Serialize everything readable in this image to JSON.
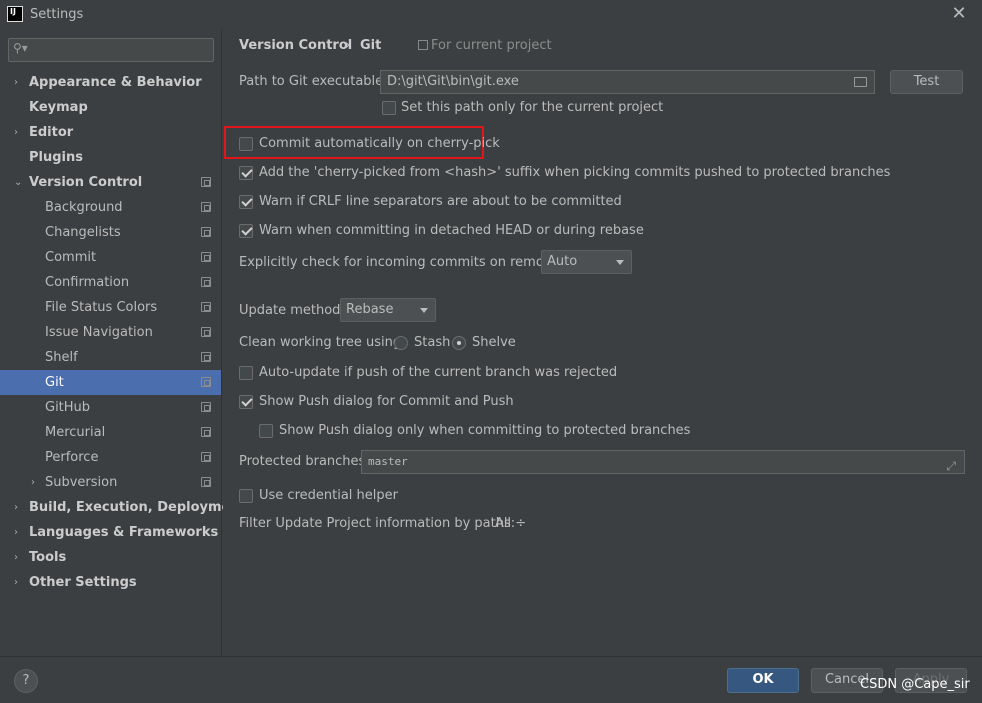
{
  "window": {
    "title": "Settings",
    "logo": "IJ",
    "close": "✕"
  },
  "search": {
    "placeholder": ""
  },
  "sidebar": {
    "items": [
      {
        "label": "Appearance & Behavior",
        "bold": true,
        "arrow": "›"
      },
      {
        "label": "Keymap",
        "bold": true
      },
      {
        "label": "Editor",
        "bold": true,
        "arrow": "›"
      },
      {
        "label": "Plugins",
        "bold": true
      },
      {
        "label": "Version Control",
        "bold": true,
        "arrow": "⌄"
      },
      {
        "label": "Background"
      },
      {
        "label": "Changelists"
      },
      {
        "label": "Commit"
      },
      {
        "label": "Confirmation"
      },
      {
        "label": "File Status Colors"
      },
      {
        "label": "Issue Navigation"
      },
      {
        "label": "Shelf"
      },
      {
        "label": "Git",
        "selected": true
      },
      {
        "label": "GitHub"
      },
      {
        "label": "Mercurial"
      },
      {
        "label": "Perforce"
      },
      {
        "label": "Subversion",
        "arrow": "›"
      },
      {
        "label": "Build, Execution, Deployment",
        "bold": true,
        "arrow": "›"
      },
      {
        "label": "Languages & Frameworks",
        "bold": true,
        "arrow": "›"
      },
      {
        "label": "Tools",
        "bold": true,
        "arrow": "›"
      },
      {
        "label": "Other Settings",
        "bold": true,
        "arrow": "›"
      }
    ]
  },
  "breadcrumb": {
    "parent": "Version Control",
    "sep": "›",
    "current": "Git",
    "scope": "For current project"
  },
  "git": {
    "path_label": "Path to Git executable:",
    "path_value": "D:\\git\\Git\\bin\\git.exe",
    "test_label": "Test",
    "set_path_only": "Set this path only for the current project",
    "commit_auto_cherry": "Commit automatically on cherry-pick",
    "add_suffix": "Add the 'cherry-picked from <hash>' suffix when picking commits pushed to protected branches",
    "warn_crlf": "Warn if CRLF line separators are about to be committed",
    "warn_detached": "Warn when committing in detached HEAD or during rebase",
    "check_incoming_label": "Explicitly check for incoming commits on remotes:",
    "check_incoming_value": "Auto",
    "update_method_label": "Update method:",
    "update_method_value": "Rebase",
    "clean_tree_label": "Clean working tree using:",
    "stash_label": "Stash",
    "shelve_label": "Shelve",
    "auto_update": "Auto-update if push of the current branch was rejected",
    "show_push_dialog": "Show Push dialog for Commit and Push",
    "show_push_protected": "Show Push dialog only when committing to protected branches",
    "protected_label": "Protected branches:",
    "protected_value": "master",
    "credential_helper": "Use credential helper",
    "filter_label": "Filter Update Project information by paths:",
    "filter_value": "All ÷"
  },
  "footer": {
    "help": "?",
    "ok": "OK",
    "cancel": "Cancel",
    "apply": "Apply",
    "watermark": "CSDN @Cape_sir"
  }
}
